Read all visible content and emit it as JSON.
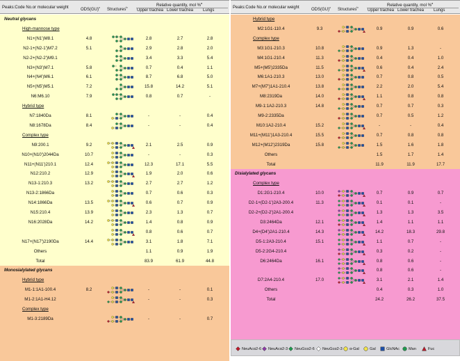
{
  "header": {
    "peaks": "Peaks:Code No.or molecular weight",
    "ods": "ODS(GU)",
    "ods_sup": "c",
    "structures": "Structures",
    "structures_sup": "b",
    "relq": "Relative quantity, mol %",
    "relq_sup": "a",
    "upper": "Upper trachea",
    "lower": "Lower trachea",
    "lungs": "Lungs"
  },
  "colors": {
    "neutral_band": "#ffffcc",
    "mono_band": "#f9c89a",
    "hybrid_band": "#f9c89a",
    "disialyl_band": "#f79ad0",
    "header_band": "#e8e8e8",
    "legend_band": "#d8d8dc"
  },
  "left": [
    {
      "kind": "section",
      "label": "Neutral glycans"
    },
    {
      "kind": "sub",
      "label": "High-mannose type"
    },
    {
      "kind": "data",
      "name": "N1+(N1')M8.1",
      "ods": "4.8",
      "u": "2.8",
      "l": "2.7",
      "g": "2.8",
      "glycan": "hm"
    },
    {
      "kind": "data",
      "name": "N2-1+(N2-1')M7.2",
      "ods": "5.1",
      "u": "2.9",
      "l": "2.8",
      "g": "2.0",
      "glycan": "hm"
    },
    {
      "kind": "data",
      "name": "N2-2+(N2-2')M9.1",
      "ods": "",
      "u": "3.4",
      "l": "3.3",
      "g": "5.4",
      "glycan": "hm"
    },
    {
      "kind": "data",
      "name": "N3+(N3')M7.1",
      "ods": "5.8",
      "u": "0.7",
      "l": "0.4",
      "g": "1.1",
      "glycan": "hm"
    },
    {
      "kind": "data",
      "name": "N4+(N4')M6.1",
      "ods": "6.1",
      "u": "8.7",
      "l": "6.8",
      "g": "5.0",
      "glycan": "hm"
    },
    {
      "kind": "data",
      "name": "N5+(N5')M5.1",
      "ods": "7.2",
      "u": "15.8",
      "l": "14.2",
      "g": "5.1",
      "glycan": "hm"
    },
    {
      "kind": "data",
      "name": "N6:M6.10",
      "ods": "7.9",
      "u": "0.8",
      "l": "0.7",
      "g": "-",
      "glycan": "hm"
    },
    {
      "kind": "sub",
      "label": "Hybrid type"
    },
    {
      "kind": "data",
      "name": "N7:1840Da",
      "ods": "8.1",
      "u": "-",
      "l": "-",
      "g": "0.4",
      "glycan": "hy"
    },
    {
      "kind": "data",
      "name": "N8:1678Da",
      "ods": "8.4",
      "u": "-",
      "l": "-",
      "g": "0.4",
      "glycan": "hy"
    },
    {
      "kind": "sub",
      "label": "Complex type"
    },
    {
      "kind": "data",
      "name": "N9:200.1",
      "ods": "9.2",
      "u": "2.1",
      "l": "2.5",
      "g": "0.9",
      "glycan": "cx"
    },
    {
      "kind": "data",
      "name": "N10+(N10')2044Da",
      "ods": "10.7",
      "u": "-",
      "l": "-",
      "g": "0.3",
      "glycan": "cx"
    },
    {
      "kind": "data",
      "name": "N11+(N11')210.1",
      "ods": "12.4",
      "u": "12.3",
      "l": "17.1",
      "g": "5.5",
      "glycan": "cx"
    },
    {
      "kind": "data",
      "name": "N12:210.2",
      "ods": "12.9",
      "u": "1.9",
      "l": "2.0",
      "g": "0.6",
      "glycan": "cx"
    },
    {
      "kind": "data",
      "name": "N13-1:210.3",
      "ods": "13.2",
      "u": "2.7",
      "l": "2.7",
      "g": "1.2",
      "glycan": "cx"
    },
    {
      "kind": "data",
      "name": "N13-2:1866Da",
      "ods": "",
      "u": "0.7",
      "l": "0.6",
      "g": "0.3",
      "glycan": "cx"
    },
    {
      "kind": "data",
      "name": "N14:1866Da",
      "ods": "13.5",
      "u": "0.6",
      "l": "0.7",
      "g": "0.9",
      "glycan": "cx"
    },
    {
      "kind": "data",
      "name": "N15:210.4",
      "ods": "13.9",
      "u": "2.3",
      "l": "1.3",
      "g": "0.7",
      "glycan": "cx"
    },
    {
      "kind": "data",
      "name": "N16:2028Da",
      "ods": "14.2",
      "u": "1.4",
      "l": "0.8",
      "g": "0.9",
      "glycan": "cx"
    },
    {
      "kind": "data",
      "name": "",
      "ods": "",
      "u": "0.8",
      "l": "0.6",
      "g": "0.7",
      "glycan": "cx"
    },
    {
      "kind": "data",
      "name": "N17+(N17')2190Da",
      "ods": "14.4",
      "u": "3.1",
      "l": "1.8",
      "g": "7.1",
      "glycan": "cx"
    },
    {
      "kind": "data",
      "name": "Others",
      "ods": "",
      "u": "1.1",
      "l": "0.9",
      "g": "1.9",
      "glycan": ""
    },
    {
      "kind": "data",
      "name": "Total",
      "ods": "",
      "u": "83.9",
      "l": "61.9",
      "g": "44.8",
      "glycan": ""
    },
    {
      "kind": "section",
      "label": "Monosialylated glycans"
    },
    {
      "kind": "sub",
      "label": "Hybrid type"
    },
    {
      "kind": "data",
      "name": "M1-1:1A1-100.4",
      "ods": "8.2",
      "u": "-",
      "l": "-",
      "g": "0.1",
      "glycan": "ms"
    },
    {
      "kind": "data",
      "name": "M1-2:1A1-H4.12",
      "ods": "",
      "u": "-",
      "l": "-",
      "g": "0.3",
      "glycan": "ms"
    },
    {
      "kind": "sub",
      "label": "Complex type"
    },
    {
      "kind": "data",
      "name": "M1-3:2189Da",
      "ods": "",
      "u": "-",
      "l": "-",
      "g": "0.7",
      "glycan": "ms"
    }
  ],
  "right": [
    {
      "kind": "sub",
      "label": "Hybrid type"
    },
    {
      "kind": "data",
      "name": "M2:1G1-110.4",
      "ods": "9.3",
      "u": "0.9",
      "l": "0.9",
      "g": "0.6",
      "glycan": "ms"
    },
    {
      "kind": "sub",
      "label": "Complex type"
    },
    {
      "kind": "data",
      "name": "M3:1G1-210.3",
      "ods": "10.8",
      "u": "0.9",
      "l": "1.3",
      "g": "-",
      "glycan": "ms"
    },
    {
      "kind": "data",
      "name": "M4:1G1-210.4",
      "ods": "11.3",
      "u": "0.4",
      "l": "0.4",
      "g": "1.0",
      "glycan": "ms"
    },
    {
      "kind": "data",
      "name": "M5+(M5')2335Da",
      "ods": "11.5",
      "u": "0.6",
      "l": "0.4",
      "g": "2.4",
      "glycan": "ms"
    },
    {
      "kind": "data",
      "name": "M6:1A1-210.3",
      "ods": "13.0",
      "u": "0.7",
      "l": "0.8",
      "g": "0.5",
      "glycan": "ms"
    },
    {
      "kind": "data",
      "name": "M7+(M7')1A1-210.4",
      "ods": "13.8",
      "u": "2.2",
      "l": "2.0",
      "g": "5.4",
      "glycan": "ms"
    },
    {
      "kind": "data",
      "name": "M8:2319Da",
      "ods": "14.0",
      "u": "1.1",
      "l": "0.8",
      "g": "0.8",
      "glycan": "ms"
    },
    {
      "kind": "data",
      "name": "M9-1:1A2-210.3",
      "ods": "14.8",
      "u": "0.7",
      "l": "0.7",
      "g": "0.3",
      "glycan": "ms"
    },
    {
      "kind": "data",
      "name": "M9-2:2335Da",
      "ods": "",
      "u": "0.7",
      "l": "0.5",
      "g": "1.2",
      "glycan": "ms"
    },
    {
      "kind": "data",
      "name": "M10:1A2-210.4",
      "ods": "15.2",
      "u": "-",
      "l": "-",
      "g": "0.4",
      "glycan": "ms"
    },
    {
      "kind": "data",
      "name": "M11+(M11')1A3-210.4",
      "ods": "15.5",
      "u": "0.7",
      "l": "0.8",
      "g": "0.8",
      "glycan": "ms"
    },
    {
      "kind": "data",
      "name": "M12+(M12')2319Da",
      "ods": "15.8",
      "u": "1.5",
      "l": "1.6",
      "g": "1.8",
      "glycan": "ms"
    },
    {
      "kind": "data",
      "name": "Others",
      "ods": "",
      "u": "1.5",
      "l": "1.7",
      "g": "1.4",
      "glycan": ""
    },
    {
      "kind": "data",
      "name": "Total",
      "ods": "",
      "u": "11.9",
      "l": "11.9",
      "g": "17.7",
      "glycan": ""
    },
    {
      "kind": "section",
      "label": "Disialylated glycans"
    },
    {
      "kind": "sub",
      "label": "Complex type"
    },
    {
      "kind": "data",
      "name": "D1:2G1-210.4",
      "ods": "10.0",
      "u": "0.7",
      "l": "0.9",
      "g": "0.7",
      "glycan": "ds"
    },
    {
      "kind": "data",
      "name": "D2-1+(D2-1')2A3-200.4",
      "ods": "11.3",
      "u": "0.1",
      "l": "0.1",
      "g": "-",
      "glycan": "ds"
    },
    {
      "kind": "data",
      "name": "D2-2+(D2-2')2A1-200.4",
      "ods": "",
      "u": "1.3",
      "l": "1.3",
      "g": "3.5",
      "glycan": "ds"
    },
    {
      "kind": "data",
      "name": "D3:2464Da",
      "ods": "12.1",
      "u": "1.4",
      "l": "1.1",
      "g": "1.1",
      "glycan": "ds"
    },
    {
      "kind": "data",
      "name": "D4+(D4')2A1-210.4",
      "ods": "14.3",
      "u": "14.2",
      "l": "18.3",
      "g": "29.8",
      "glycan": "ds"
    },
    {
      "kind": "data",
      "name": "D5-1:2A3-210.4",
      "ods": "15.1",
      "u": "1.1",
      "l": "0.7",
      "g": "-",
      "glycan": "ds"
    },
    {
      "kind": "data",
      "name": "D5-2:2G4-210.4",
      "ods": "",
      "u": "0.3",
      "l": "0.2",
      "g": "-",
      "glycan": "ds"
    },
    {
      "kind": "data",
      "name": "D6:2464Da",
      "ods": "16.1",
      "u": "0.8",
      "l": "0.6",
      "g": "-",
      "glycan": "ds"
    },
    {
      "kind": "data",
      "name": "",
      "ods": "",
      "u": "0.8",
      "l": "0.6",
      "g": "-",
      "glycan": "ds"
    },
    {
      "kind": "data",
      "name": "D7:2A4-210.4",
      "ods": "17.0",
      "u": "3.1",
      "l": "2.1",
      "g": "1.4",
      "glycan": "ds"
    },
    {
      "kind": "data",
      "name": "Others",
      "ods": "",
      "u": "0.4",
      "l": "0.3",
      "g": "1.0",
      "glycan": ""
    },
    {
      "kind": "data",
      "name": "Total",
      "ods": "",
      "u": "24.2",
      "l": "26.2",
      "g": "37.5",
      "glycan": ""
    }
  ],
  "legend": [
    {
      "label": "NeuAcα2-6",
      "shape": "diamond",
      "color": "#c0192a"
    },
    {
      "label": "NeuAcα2-3",
      "shape": "diamond",
      "color": "#8e3aa8"
    },
    {
      "label": "NeuGcα2-6",
      "shape": "diamond",
      "color": "#1f9a4e"
    },
    {
      "label": "NeuGcα2-3",
      "shape": "diamond",
      "color": "#ffffff"
    },
    {
      "label": "α-Gal",
      "shape": "circle",
      "color": "#f2e44a"
    },
    {
      "label": "Gal",
      "shape": "circle",
      "color": "#f2e44a"
    },
    {
      "label": "GlcNAc",
      "shape": "square",
      "color": "#1d4fa8"
    },
    {
      "label": "Man",
      "shape": "circle",
      "color": "#1f9a4e"
    },
    {
      "label": "Fuc",
      "shape": "triangle",
      "color": "#c0192a"
    }
  ]
}
